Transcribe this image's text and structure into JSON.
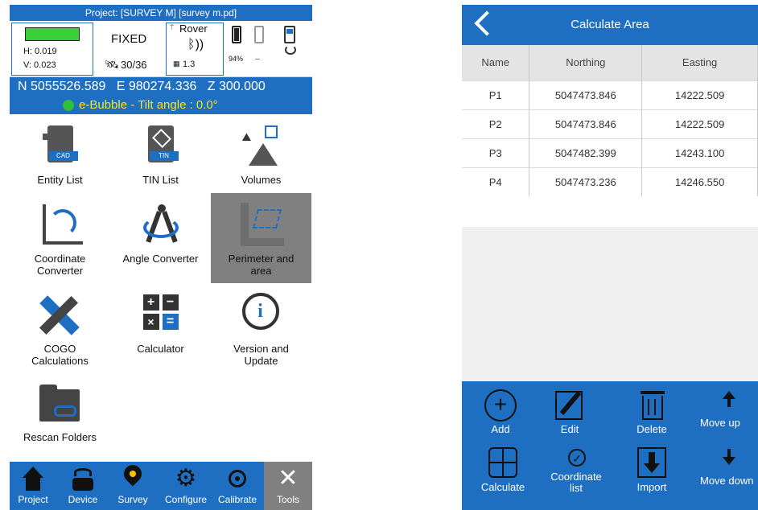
{
  "left": {
    "project_bar": "Project: [SURVEY M] [survey m.pd]",
    "status": {
      "h": "H: 0.019",
      "v": "V: 0.023",
      "fix": "FIXED",
      "sats": "30/36",
      "rover": "Rover",
      "pdop": "1.3",
      "battery1": "94%",
      "battery2": "--"
    },
    "coords": "N 5055526.589   E 980274.336   Z 300.000",
    "bubble": "e-Bubble - Tilt angle : 0.0°",
    "tiles": [
      {
        "label": "Entity List",
        "icon": "cad-file-icon"
      },
      {
        "label": "TIN List",
        "icon": "tin-file-icon"
      },
      {
        "label": "Volumes",
        "icon": "volumes-icon"
      },
      {
        "label": "Coordinate Converter",
        "icon": "coordinate-converter-icon"
      },
      {
        "label": "Angle Converter",
        "icon": "angle-converter-icon"
      },
      {
        "label": "Perimeter and area",
        "icon": "perimeter-area-icon"
      },
      {
        "label": "COGO Calculations",
        "icon": "cogo-icon"
      },
      {
        "label": "Calculator",
        "icon": "calculator-icon"
      },
      {
        "label": "Version and Update",
        "icon": "info-icon"
      },
      {
        "label": "Rescan Folders",
        "icon": "folder-icon"
      }
    ],
    "nav": [
      {
        "label": "Project",
        "icon": "home-icon"
      },
      {
        "label": "Device",
        "icon": "receiver-icon"
      },
      {
        "label": "Survey",
        "icon": "location-pin-icon"
      },
      {
        "label": "Configure",
        "icon": "gear-icon"
      },
      {
        "label": "Calibrate",
        "icon": "crosshair-icon"
      },
      {
        "label": "Tools",
        "icon": "tools-icon"
      }
    ]
  },
  "right": {
    "title": "Calculate Area",
    "columns": [
      "Name",
      "Northing",
      "Easting"
    ],
    "rows": [
      [
        "P1",
        "5047473.846",
        "14222.509"
      ],
      [
        "P2",
        "5047473.846",
        "14222.509"
      ],
      [
        "P3",
        "5047482.399",
        "14243.100"
      ],
      [
        "P4",
        "5047473.236",
        "14246.550"
      ]
    ],
    "toolbar": {
      "add": "Add",
      "edit": "Edit",
      "delete": "Delete",
      "move_up": "Move up",
      "calculate": "Calculate",
      "coordinate_list": "Coordinate list",
      "import": "Import",
      "move_down": "Move down"
    }
  },
  "colors": {
    "brand_blue": "#1e6fc1",
    "selected_gray": "#808080",
    "fix_green": "#3ad03a",
    "bubble_text": "#f5e61a"
  }
}
